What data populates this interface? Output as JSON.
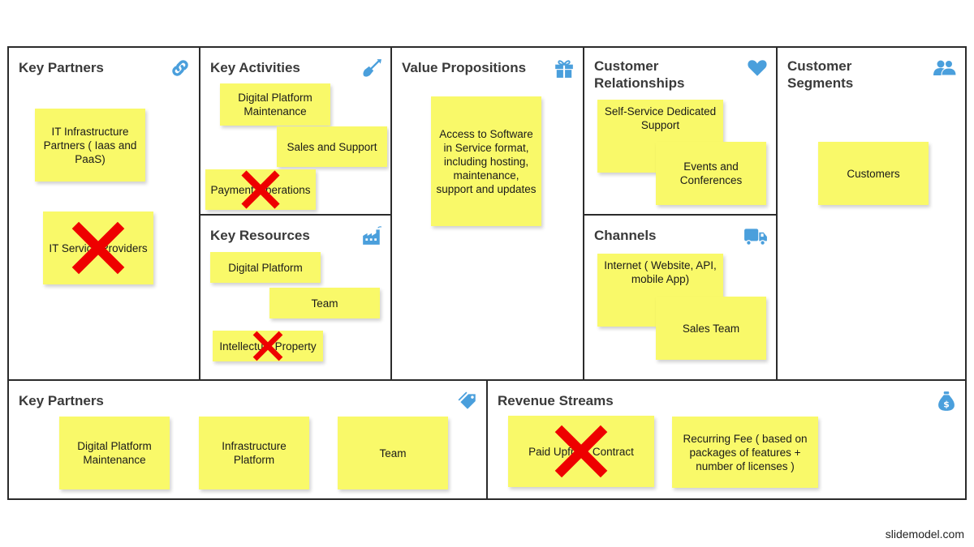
{
  "colors": {
    "note_fill": "#f9f969",
    "icon_blue": "#4a9fdc",
    "cross_red": "#ee0000",
    "border": "#2b2b2b",
    "title_text": "#3a3a3a"
  },
  "canvas": {
    "key_partners": {
      "title": "Key Partners",
      "icon": "link-icon",
      "notes": [
        {
          "text": "IT Infrastructure Partners ( Iaas and PaaS)",
          "crossed_out": false
        },
        {
          "text": "IT Service Providers",
          "crossed_out": true
        }
      ]
    },
    "key_activities": {
      "title": "Key Activities",
      "icon": "shovel-icon",
      "notes": [
        {
          "text": "Digital Platform Maintenance",
          "crossed_out": false
        },
        {
          "text": "Sales and Support",
          "crossed_out": false
        },
        {
          "text": "Payment Operations",
          "crossed_out": true
        }
      ]
    },
    "key_resources": {
      "title": "Key Resources",
      "icon": "factory-icon",
      "notes": [
        {
          "text": "Digital Platform",
          "crossed_out": false
        },
        {
          "text": "Team",
          "crossed_out": false
        },
        {
          "text": "Intellectual Property",
          "crossed_out": true
        }
      ]
    },
    "value_propositions": {
      "title": "Value Propositions",
      "icon": "gift-icon",
      "notes": [
        {
          "text": "Access to Software in Service format, including hosting, maintenance, support and updates",
          "crossed_out": false
        }
      ]
    },
    "customer_relationships": {
      "title": "Customer\nRelationships",
      "icon": "heart-icon",
      "notes": [
        {
          "text": "Self-Service Dedicated Support",
          "crossed_out": false
        },
        {
          "text": "Events and Conferences",
          "crossed_out": false
        }
      ]
    },
    "channels": {
      "title": "Channels",
      "icon": "truck-icon",
      "notes": [
        {
          "text": "Internet ( Website, API, mobile App)",
          "crossed_out": false
        },
        {
          "text": "Sales Team",
          "crossed_out": false
        }
      ]
    },
    "customer_segments": {
      "title": "Customer\nSegments",
      "icon": "users-icon",
      "notes": [
        {
          "text": "Customers",
          "crossed_out": false
        }
      ]
    },
    "cost_structure": {
      "title": "Key Partners",
      "icon": "tag-icon",
      "notes": [
        {
          "text": "Digital Platform Maintenance",
          "crossed_out": false
        },
        {
          "text": "Infrastructure Platform",
          "crossed_out": false
        },
        {
          "text": "Team",
          "crossed_out": false
        }
      ]
    },
    "revenue_streams": {
      "title": "Revenue Streams",
      "icon": "money-bag-icon",
      "notes": [
        {
          "text": "Paid Upfront Contract",
          "crossed_out": true
        },
        {
          "text": "Recurring Fee ( based on packages of features + number of licenses )",
          "crossed_out": false
        }
      ]
    }
  },
  "footer": {
    "credit": "slidemodel.com"
  }
}
